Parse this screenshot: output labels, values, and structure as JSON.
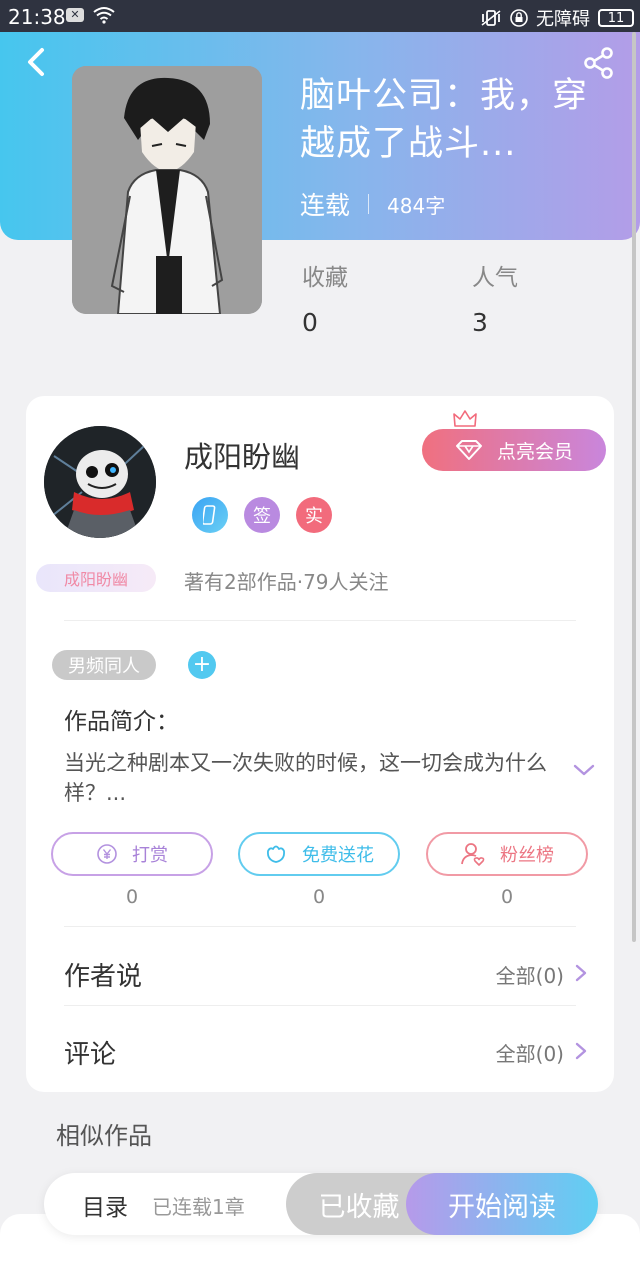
{
  "status_bar": {
    "time": "21:38",
    "accessibility": "无障碍",
    "battery": "11"
  },
  "book": {
    "title": "脑叶公司：我，穿越成了战斗...",
    "serial_status": "连载",
    "word_count": "484字",
    "stats": [
      {
        "label": "收藏",
        "value": "0"
      },
      {
        "label": "人气",
        "value": "3"
      }
    ]
  },
  "author": {
    "name": "成阳盼幽",
    "tag": "成阳盼幽",
    "badges": [
      "",
      "签",
      "实"
    ],
    "summary": "著有2部作品·79人关注",
    "vip_button": "点亮会员"
  },
  "intro": {
    "genre_tag": "男频同人",
    "add_tag": "+",
    "label": "作品简介：",
    "text": "当光之种剧本又一次失败的时候，这一切会成为什么样？..."
  },
  "actions": [
    {
      "label": "打赏",
      "count": "0",
      "icon": "yen-icon"
    },
    {
      "label": "免费送花",
      "count": "0",
      "icon": "flower-icon"
    },
    {
      "label": "粉丝榜",
      "count": "0",
      "icon": "fan-icon"
    }
  ],
  "rows": [
    {
      "label": "作者说",
      "right": "全部(0)"
    },
    {
      "label": "评论",
      "right": "全部(0)"
    }
  ],
  "similar_label": "相似作品",
  "bottom_bar": {
    "toc": "目录",
    "chapters": "已连载1章",
    "collected": "已收藏",
    "start_reading": "开始阅读"
  },
  "colors": {
    "header_gradient": [
      "#46c6ee",
      "#b39de8"
    ],
    "vip_gradient": [
      "#f0707f",
      "#c986dc"
    ],
    "read_gradient": [
      "#b69aea",
      "#5fcff3"
    ]
  }
}
